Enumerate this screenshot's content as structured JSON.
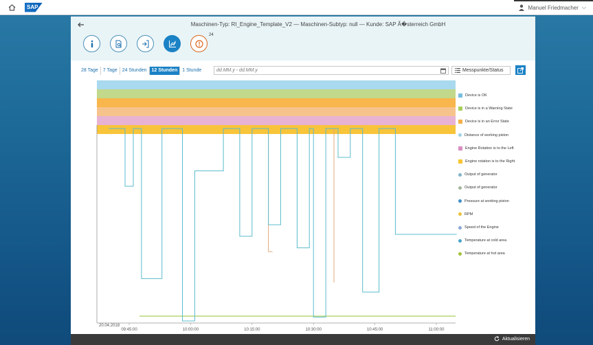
{
  "shell": {
    "user_name": "Manuel Friedmacher",
    "logo_text": "SAP"
  },
  "header": {
    "title": "Maschinen-Typ: RI_Engine_Template_V2 — Maschinen-Subtyp: null — Kunde: SAP Ã�sterreich GmbH",
    "alert_count": "24",
    "tabs": [
      {
        "icon": "info-icon",
        "active": false
      },
      {
        "icon": "document-search-icon",
        "active": false
      },
      {
        "icon": "import-icon",
        "active": false
      },
      {
        "icon": "chart-icon",
        "active": true
      },
      {
        "icon": "alert-icon",
        "active": false
      }
    ]
  },
  "toolbar": {
    "ranges": [
      "28 Tage",
      "7 Tage",
      "24 Stunden",
      "12 Stunden",
      "1 Stunde"
    ],
    "active_range": "12 Stunden",
    "date_placeholder": "dd.MM.y - dd.MM.y",
    "measure_button": "Messpunkte/Status"
  },
  "footer": {
    "refresh_label": "Aktualisieren"
  },
  "colors": {
    "accent": "#1b82c5",
    "status_ok": "#a9d9ee",
    "status_warning": "#c2d88a",
    "status_error": "#f8b64c",
    "piston_distance": "#f6c38c",
    "rotation_left": "#e8b3d3",
    "rotation_right": "#f8c43a",
    "line_main": "#5bbccc",
    "line_orange": "#e3a06a",
    "line_green": "#a9cf5a"
  },
  "chart_data": {
    "type": "line",
    "date_label": "20.04.2018",
    "x_ticks": [
      "09:45:00",
      "10:00:00",
      "10:15:00",
      "10:30:00",
      "10:45:00",
      "11:00:00"
    ],
    "status_bands": [
      {
        "name": "Device is OK",
        "color": "#a9d9ee"
      },
      {
        "name": "Device is in a Warning State",
        "color": "#c2d88a"
      },
      {
        "name": "Device is in an Error State",
        "color": "#f8b64c"
      },
      {
        "name": "Distance of working piston",
        "color": "#f6c38c"
      },
      {
        "name": "Engine Rotation is to the Left",
        "color": "#e8b3d3"
      },
      {
        "name": "Engine rotation is to the Right",
        "color": "#f8c43a"
      }
    ],
    "legend": [
      {
        "label": "Device is OK",
        "color": "#78bde0",
        "shape": "square"
      },
      {
        "label": "Device is in a Warning State",
        "color": "#a9cf5a",
        "shape": "square"
      },
      {
        "label": "Device is in an Error State",
        "color": "#f3b04a",
        "shape": "square"
      },
      {
        "label": "Distance of working piston",
        "color": "#9ed0e6",
        "shape": "dot"
      },
      {
        "label": "Engine Rotation is to the Left",
        "color": "#d98fc0",
        "shape": "square"
      },
      {
        "label": "Engine rotation is to the Right",
        "color": "#f6c530",
        "shape": "square"
      },
      {
        "label": "Output of generator",
        "color": "#7fb3c7",
        "shape": "dot"
      },
      {
        "label": "Output of generator",
        "color": "#a6b59a",
        "shape": "dot"
      },
      {
        "label": "Pressure at working piston",
        "color": "#3f8fc7",
        "shape": "dot"
      },
      {
        "label": "RPM",
        "color": "#e8c23a",
        "shape": "dot"
      },
      {
        "label": "Speed of the Engine",
        "color": "#8aa8d6",
        "shape": "dot"
      },
      {
        "label": "Temperature at cold area",
        "color": "#4aa5c9",
        "shape": "dot"
      },
      {
        "label": "Temperature at hot area",
        "color": "#a4c23a",
        "shape": "dot"
      }
    ],
    "series": [
      {
        "x": [
          "09:40:00",
          "09:44:00",
          "09:44:00",
          "09:46:00",
          "09:46:00",
          "09:48:00",
          "09:48:00",
          "09:53:00",
          "09:53:00",
          "09:58:00",
          "09:58:00",
          "10:01:00",
          "10:01:00",
          "10:08:00",
          "10:08:00",
          "10:12:00",
          "10:12:00",
          "10:15:00",
          "10:15:00",
          "10:19:00",
          "10:19:00",
          "10:22:00",
          "10:22:00",
          "10:26:00",
          "10:26:00",
          "10:29:00",
          "10:29:00",
          "10:30:00",
          "10:30:00",
          "10:33:00",
          "10:33:00",
          "10:36:00",
          "10:36:00",
          "10:39:00",
          "10:39:00",
          "10:42:00",
          "10:42:00",
          "10:46:00",
          "10:46:00",
          "10:50:00",
          "10:50:00",
          "11:05:00"
        ],
        "values": [
          100,
          100,
          70,
          70,
          100,
          100,
          22,
          22,
          100,
          100,
          0,
          0,
          78,
          78,
          100,
          100,
          44,
          44,
          100,
          100,
          50,
          50,
          100,
          100,
          38,
          38,
          100,
          100,
          2,
          2,
          100,
          100,
          85,
          85,
          100,
          100,
          15,
          15,
          100,
          100,
          45,
          45
        ]
      }
    ]
  }
}
